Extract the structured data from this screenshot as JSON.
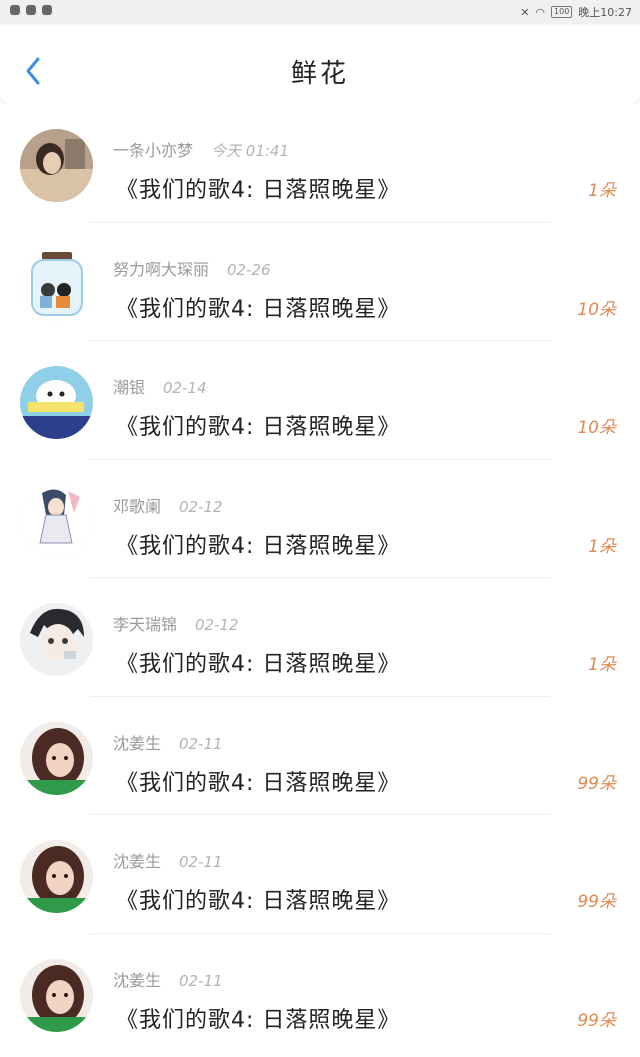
{
  "status_bar": {
    "time": "晚上10:27",
    "battery": "100"
  },
  "header": {
    "title": "鲜花"
  },
  "colors": {
    "accent": "#3a8ee6",
    "count": "#e08a52"
  },
  "gifts": [
    {
      "user": "一条小亦梦",
      "time": "今天 01:41",
      "song": "《我们的歌4: 日落照晚星》",
      "count": "1朵",
      "avatar": "girl-photo"
    },
    {
      "user": "努力啊大琛丽",
      "time": "02-26",
      "song": "《我们的歌4: 日落照晚星》",
      "count": "10朵",
      "avatar": "jar-illustration"
    },
    {
      "user": "潮银",
      "time": "02-14",
      "song": "《我们的歌4: 日落照晚星》",
      "count": "10朵",
      "avatar": "gemini-cartoon"
    },
    {
      "user": "邓歌阑",
      "time": "02-12",
      "song": "《我们的歌4: 日落照晚星》",
      "count": "1朵",
      "avatar": "anime-girl"
    },
    {
      "user": "李天瑞锦",
      "time": "02-12",
      "song": "《我们的歌4: 日落照晚星》",
      "count": "1朵",
      "avatar": "anime-boy"
    },
    {
      "user": "沈姜生",
      "time": "02-11",
      "song": "《我们的歌4: 日落照晚星》",
      "count": "99朵",
      "avatar": "woman-photo"
    },
    {
      "user": "沈姜生",
      "time": "02-11",
      "song": "《我们的歌4: 日落照晚星》",
      "count": "99朵",
      "avatar": "woman-photo"
    },
    {
      "user": "沈姜生",
      "time": "02-11",
      "song": "《我们的歌4: 日落照晚星》",
      "count": "99朵",
      "avatar": "woman-photo"
    }
  ]
}
